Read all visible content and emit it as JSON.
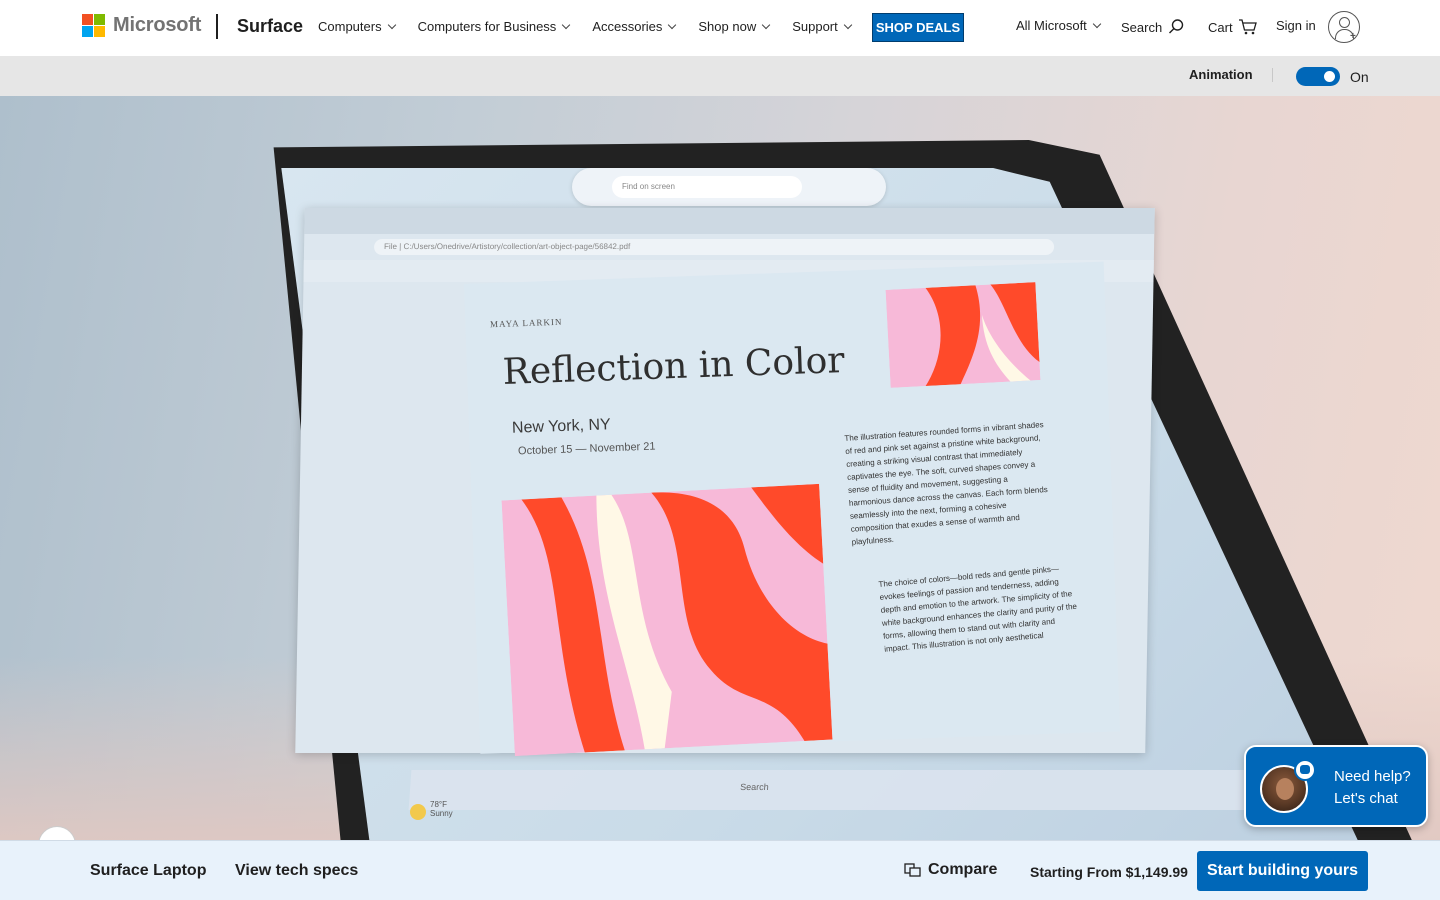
{
  "header": {
    "logo_text": "Microsoft",
    "brand": "Surface",
    "nav": [
      "Computers",
      "Computers for Business",
      "Accessories",
      "Shop now",
      "Support"
    ],
    "deals_label": "SHOP DEALS",
    "all_microsoft": "All Microsoft",
    "search_label": "Search",
    "cart_label": "Cart",
    "signin_label": "Sign in"
  },
  "animation_bar": {
    "label": "Animation",
    "state": "On"
  },
  "hero": {
    "search_placeholder": "Find on screen",
    "address": "File | C:/Users/Onedrive/Artistory/collection/art-object-page/56842.pdf",
    "doc_author": "MAYA LARKIN",
    "doc_title": "Reflection in Color",
    "doc_city": "New York, NY",
    "doc_dates": "October 15 — November 21",
    "doc_body_1": "The illustration features rounded forms in vibrant shades of red and pink set against a pristine white background, creating a striking visual contrast that immediately captivates the eye. The soft, curved shapes convey a sense of fluidity and movement, suggesting a harmonious dance across the canvas. Each form blends seamlessly into the next, forming a cohesive composition that exudes a sense of warmth and playfulness.",
    "doc_body_2": "The choice of colors—bold reds and gentle pinks—evokes feelings of passion and tenderness, adding depth and emotion to the artwork. The simplicity of the white background enhances the clarity and purity of the forms, allowing them to stand out with clarity and impact. This illustration is not only aesthetical",
    "weather_temp": "78°F",
    "weather_desc": "Sunny",
    "taskbar_search": "Search"
  },
  "chat": {
    "line1": "Need help?",
    "line2": "Let's chat"
  },
  "bottom_bar": {
    "product": "Surface Laptop",
    "specs": "View tech specs",
    "compare": "Compare",
    "price": "Starting From $1,149.99",
    "cta": "Start building yours"
  },
  "colors": {
    "accent": "#0067b8",
    "logo_red": "#f25022",
    "logo_green": "#7fba00",
    "logo_blue": "#00a4ef",
    "logo_yellow": "#ffb900"
  }
}
